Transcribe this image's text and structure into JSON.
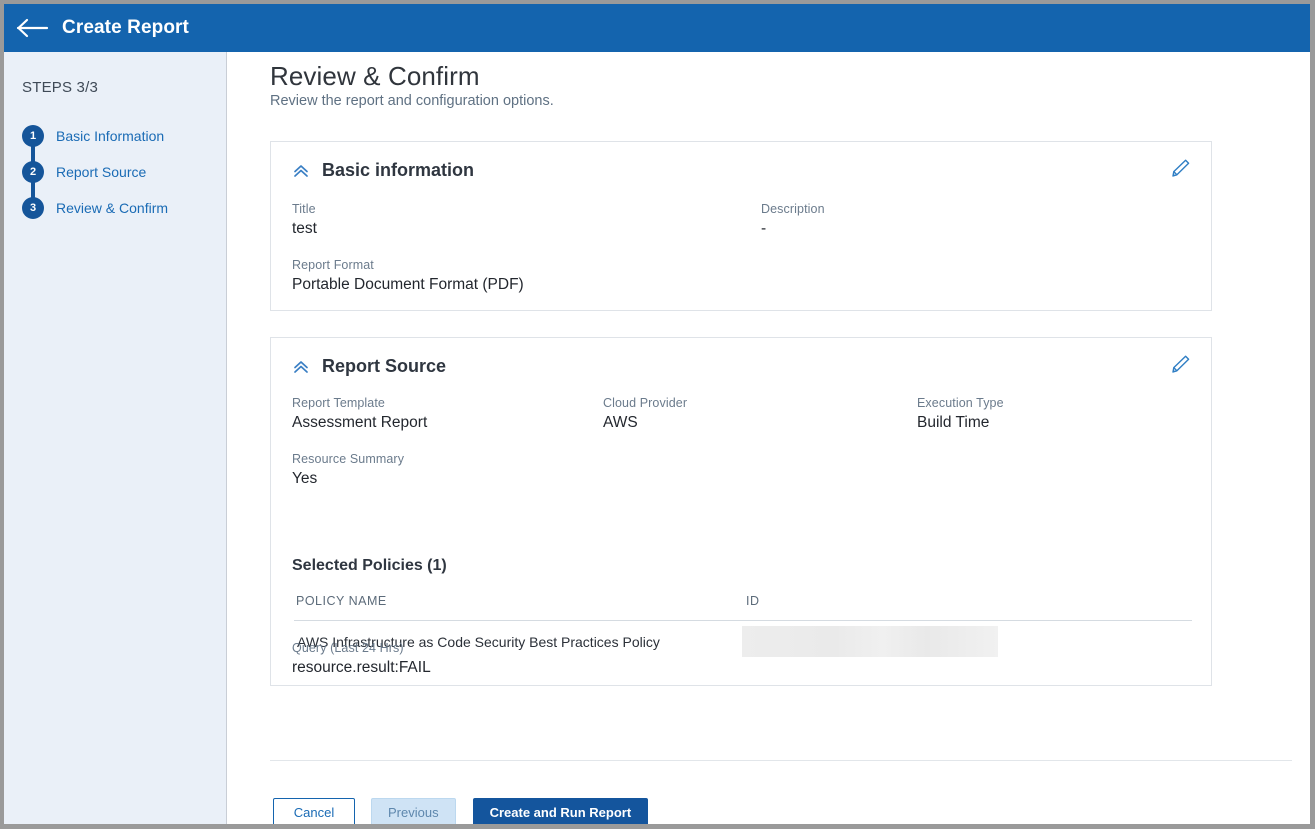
{
  "appbar": {
    "back_icon": "arrow-left-icon",
    "title": "Create Report"
  },
  "sidebar": {
    "steps_label": "STEPS 3/3",
    "steps": [
      {
        "number": "1",
        "label": "Basic Information"
      },
      {
        "number": "2",
        "label": "Report Source"
      },
      {
        "number": "3",
        "label": "Review & Confirm"
      }
    ]
  },
  "page": {
    "title": "Review & Confirm",
    "subtitle": "Review the report and configuration options."
  },
  "basic_information": {
    "title": "Basic information",
    "collapse_icon": "chevron-double-up-icon",
    "edit_icon": "pencil-icon",
    "fields": [
      {
        "label": "Title",
        "value": "test"
      },
      {
        "label": "Description",
        "value": "-"
      },
      {
        "label": "Report Format",
        "value": "Portable Document Format (PDF)"
      }
    ]
  },
  "report_source": {
    "title": "Report Source",
    "collapse_icon": "chevron-double-up-icon",
    "edit_icon": "pencil-icon",
    "fields": [
      {
        "label": "Report Template",
        "value": "Assessment Report"
      },
      {
        "label": "Cloud Provider",
        "value": "AWS"
      },
      {
        "label": "Execution Type",
        "value": "Build Time"
      },
      {
        "label": "Resource Summary",
        "value": "Yes"
      }
    ],
    "selected_policies_title": "Selected Policies (1)",
    "policies_table": {
      "columns": [
        "POLICY NAME",
        "ID"
      ],
      "rows": [
        {
          "policy_name": "AWS Infrastructure as Code Security Best Practices Policy",
          "id": ""
        }
      ]
    },
    "query": {
      "label": "Query (Last 24 Hrs)",
      "value": "resource.result:FAIL"
    }
  },
  "footer": {
    "cancel_label": "Cancel",
    "previous_label": "Previous",
    "submit_label": "Create and Run Report"
  },
  "colors": {
    "appbar_blue": "#1464ae",
    "primary_blue": "#14559d",
    "link_blue": "#1a6bb5",
    "sidebar_bg": "#eaf0f8",
    "redacted_grey": "#ededed"
  }
}
